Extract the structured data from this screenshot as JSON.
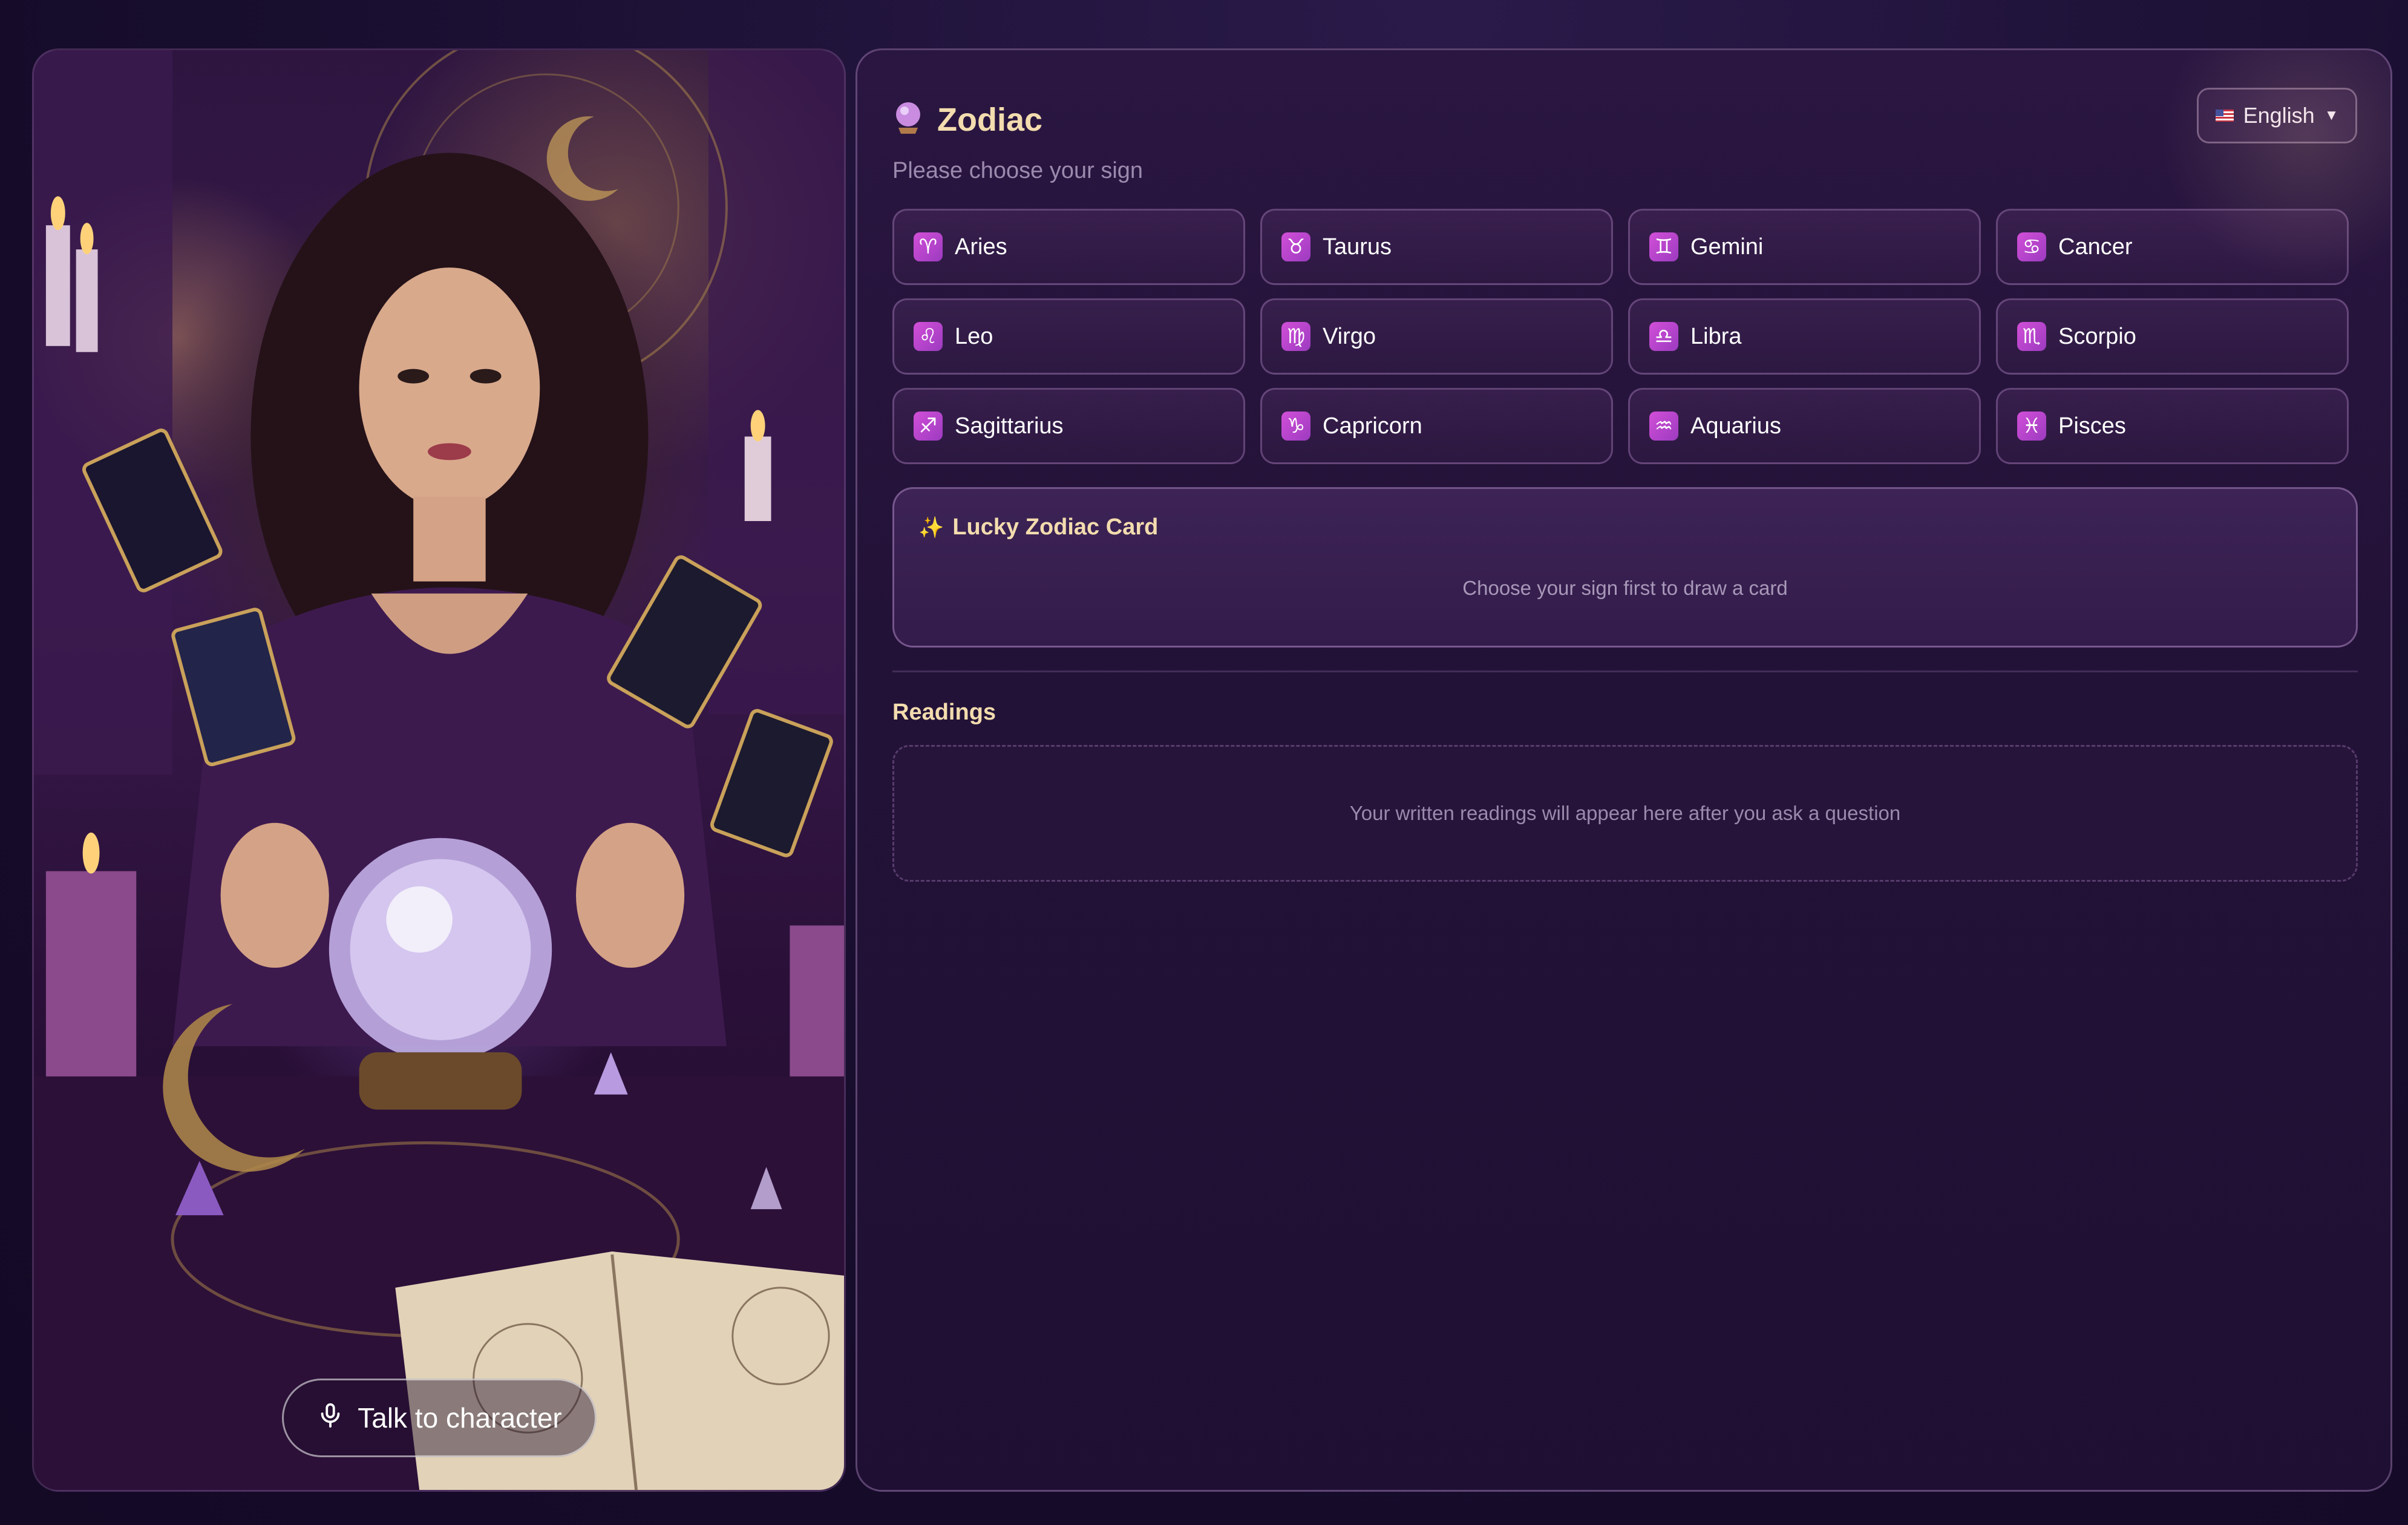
{
  "character": {
    "talk_label": "Talk to character"
  },
  "app": {
    "title": "Zodiac",
    "subtitle": "Please choose your sign",
    "language": {
      "selected": "English",
      "flag": "us-flag-icon"
    }
  },
  "signs": [
    {
      "label": "Aries",
      "glyph": "♈"
    },
    {
      "label": "Taurus",
      "glyph": "♉"
    },
    {
      "label": "Gemini",
      "glyph": "♊"
    },
    {
      "label": "Cancer",
      "glyph": "♋"
    },
    {
      "label": "Leo",
      "glyph": "♌"
    },
    {
      "label": "Virgo",
      "glyph": "♍"
    },
    {
      "label": "Libra",
      "glyph": "♎"
    },
    {
      "label": "Scorpio",
      "glyph": "♏"
    },
    {
      "label": "Sagittarius",
      "glyph": "♐"
    },
    {
      "label": "Capricorn",
      "glyph": "♑"
    },
    {
      "label": "Aquarius",
      "glyph": "♒"
    },
    {
      "label": "Pisces",
      "glyph": "♓"
    }
  ],
  "lucky_card": {
    "title": "Lucky Zodiac Card",
    "message": "Choose your sign first to draw a card"
  },
  "readings": {
    "title": "Readings",
    "empty_message": "Your written readings will appear here after you ask a question"
  },
  "colors": {
    "accent_gold": "#f3dcae",
    "icon_magenta": "#d24fd8",
    "panel_bg": "#231238"
  }
}
